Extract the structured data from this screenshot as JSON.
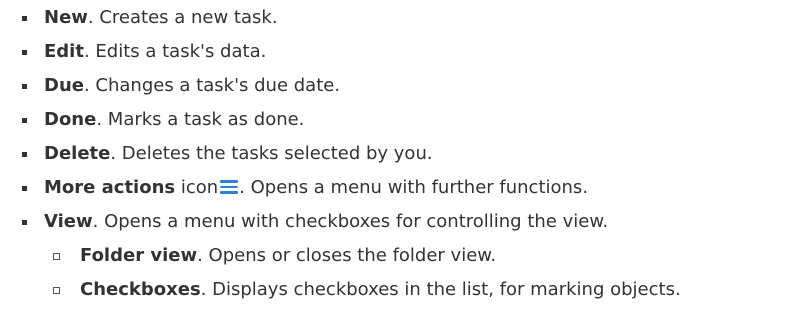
{
  "items": [
    {
      "term": "New",
      "desc": ". Creates a new task."
    },
    {
      "term": "Edit",
      "desc": ". Edits a task's data."
    },
    {
      "term": "Due",
      "desc": ". Changes a task's due date."
    },
    {
      "term": "Done",
      "desc": ". Marks a task as done."
    },
    {
      "term": "Delete",
      "desc": ". Deletes the tasks selected by you."
    },
    {
      "term": "More actions",
      "pre_icon": " icon",
      "icon": "hamburger-menu-icon",
      "desc": ". Opens a menu with further functions."
    },
    {
      "term": "View",
      "desc": ". Opens a menu with checkboxes for controlling the view.",
      "subitems": [
        {
          "term": "Folder view",
          "desc": ". Opens or closes the folder view."
        },
        {
          "term": "Checkboxes",
          "desc": ". Displays checkboxes in the list, for marking objects."
        }
      ]
    }
  ],
  "colors": {
    "text": "#333333",
    "icon_accent": "#2f7fd6"
  }
}
